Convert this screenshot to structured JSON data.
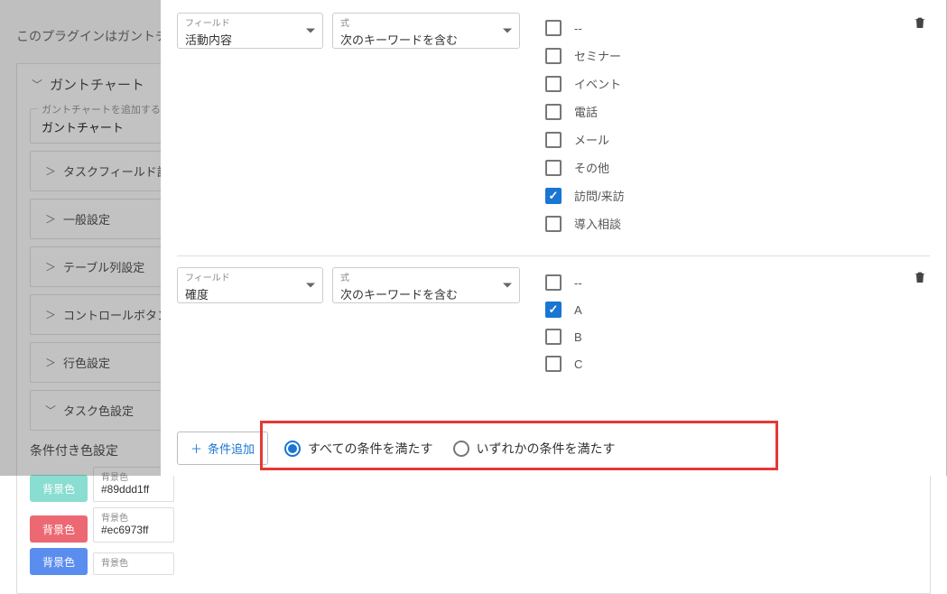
{
  "bg": {
    "intro": "このプラグインはガントチ",
    "panel_title": "ガントチャート",
    "view_fs_label": "ガントチャートを追加する Vie",
    "view_value": "ガントチャート",
    "sections": [
      "タスクフィールド設定",
      "一般設定",
      "テーブル列設定",
      "コントロールボタン設定",
      "行色設定",
      "タスク色設定"
    ],
    "color_heading": "条件付き色設定",
    "color_btn": "背景色",
    "color_lbl": "背景色",
    "colors": [
      "#89ddd1ff",
      "#ec6973ff"
    ]
  },
  "modal": {
    "field_label": "フィールド",
    "expr_label": "式",
    "expr_value": "次のキーワードを含む",
    "conditions": [
      {
        "field": "活動内容",
        "options": [
          {
            "label": "--",
            "checked": false
          },
          {
            "label": "セミナー",
            "checked": false
          },
          {
            "label": "イベント",
            "checked": false
          },
          {
            "label": "電話",
            "checked": false
          },
          {
            "label": "メール",
            "checked": false
          },
          {
            "label": "その他",
            "checked": false
          },
          {
            "label": "訪問/来訪",
            "checked": true
          },
          {
            "label": "導入相談",
            "checked": false
          }
        ]
      },
      {
        "field": "確度",
        "options": [
          {
            "label": "--",
            "checked": false
          },
          {
            "label": "A",
            "checked": true
          },
          {
            "label": "B",
            "checked": false
          },
          {
            "label": "C",
            "checked": false
          }
        ]
      }
    ],
    "add_btn": "条件追加",
    "logic": {
      "all": "すべての条件を満たす",
      "any": "いずれかの条件を満たす",
      "selected": "all"
    }
  }
}
